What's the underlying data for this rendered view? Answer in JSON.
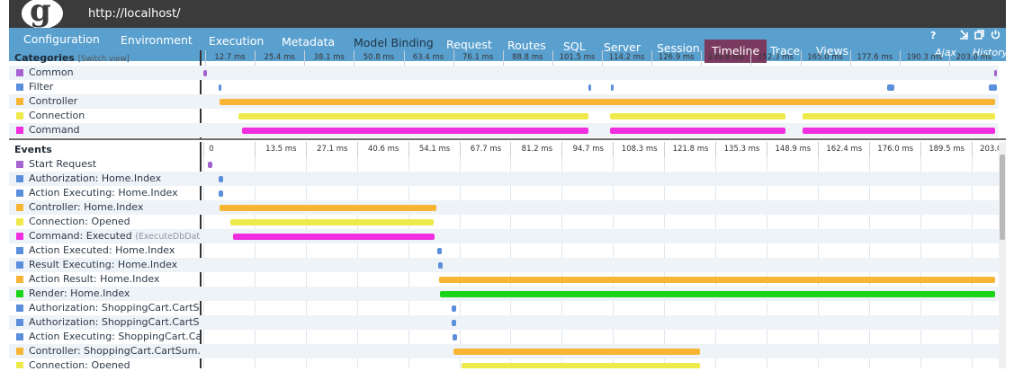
{
  "app": {
    "url": "http://localhost/",
    "logo_letter": "g"
  },
  "tabs": [
    {
      "label": "Configuration"
    },
    {
      "label": "Environment"
    },
    {
      "label": "Execution"
    },
    {
      "label": "Metadata"
    },
    {
      "label": "Model Binding"
    },
    {
      "label": "Request"
    },
    {
      "label": "Routes"
    },
    {
      "label": "SQL"
    },
    {
      "label": "Server"
    },
    {
      "label": "Session"
    },
    {
      "label": "Timeline",
      "active": true
    },
    {
      "label": "Trace"
    },
    {
      "label": "Views"
    },
    {
      "label": "Ajax"
    },
    {
      "label": "History"
    }
  ],
  "controls": {
    "help": "?",
    "popout_icon": "popout-icon",
    "restore_icon": "restore-icon",
    "power_icon": "power-icon"
  },
  "categories": {
    "title": "Categories",
    "switch_view": "[Switch view]",
    "ticks": [
      "12.7 ms",
      "25.4 ms",
      "38.1 ms",
      "50.8 ms",
      "63.4 ms",
      "76.1 ms",
      "88.8 ms",
      "101.5 ms",
      "114.2 ms",
      "126.9 ms",
      "139.6 ms",
      "152.3 ms",
      "165.0 ms",
      "177.6 ms",
      "190.3 ms",
      "203.0 ms"
    ],
    "items": [
      {
        "label": "Common",
        "color": "#a463cf"
      },
      {
        "label": "Filter",
        "color": "#5b8edb"
      },
      {
        "label": "Controller",
        "color": "#f8b533"
      },
      {
        "label": "Connection",
        "color": "#eeea4b"
      },
      {
        "label": "Command",
        "color": "#f02ee0"
      }
    ]
  },
  "events": {
    "title": "Events",
    "ticks": [
      "0",
      "13.5 ms",
      "27.1 ms",
      "40.6 ms",
      "54.1 ms",
      "67.7 ms",
      "81.2 ms",
      "94.7 ms",
      "108.3 ms",
      "121.8 ms",
      "135.3 ms",
      "148.9 ms",
      "162.4 ms",
      "176.0 ms",
      "189.5 ms",
      "203.0 ms"
    ],
    "items": [
      {
        "label": "Start Request",
        "category": "Common",
        "color": "#a463cf",
        "start_ms": 1.2,
        "end_ms": 2.2
      },
      {
        "label": "Authorization: Home.Index",
        "category": "Filter",
        "color": "#5b8edb",
        "start_ms": 3.8,
        "end_ms": 4.8
      },
      {
        "label": "Action Executing: Home.Index",
        "category": "Filter",
        "color": "#5b8edb",
        "start_ms": 4.0,
        "end_ms": 5.0
      },
      {
        "label": "Controller: Home.Index",
        "category": "Controller",
        "color": "#f8b533",
        "start_ms": 4.2,
        "end_ms": 59.5
      },
      {
        "label": "Connection: Opened",
        "category": "Connection",
        "color": "#eeea4b",
        "start_ms": 6.8,
        "end_ms": 59.0
      },
      {
        "label": "Command: Executed",
        "sub": "(ExecuteDbData...",
        "category": "Command",
        "color": "#f02ee0",
        "start_ms": 7.5,
        "end_ms": 59.2
      },
      {
        "label": "Action Executed: Home.Index",
        "category": "Filter",
        "color": "#5b8edb",
        "start_ms": 59.9,
        "end_ms": 60.9
      },
      {
        "label": "Result Executing: Home.Index",
        "category": "Filter",
        "color": "#5b8edb",
        "start_ms": 60.1,
        "end_ms": 61.1
      },
      {
        "label": "Action Result: Home.Index",
        "category": "Controller",
        "color": "#f8b533",
        "start_ms": 60.3,
        "end_ms": 202.5
      },
      {
        "label": "Render: Home.Index",
        "category": "Render",
        "color": "#1bd418",
        "start_ms": 60.6,
        "end_ms": 202.5
      },
      {
        "label": "Authorization: ShoppingCart.CartSu...",
        "category": "Filter",
        "color": "#5b8edb",
        "start_ms": 63.5,
        "end_ms": 64.5
      },
      {
        "label": "Authorization: ShoppingCart.CartSu...",
        "category": "Filter",
        "color": "#5b8edb",
        "start_ms": 63.6,
        "end_ms": 64.6
      },
      {
        "label": "Action Executing: ShoppingCart.Car...",
        "category": "Filter",
        "color": "#5b8edb",
        "start_ms": 63.7,
        "end_ms": 64.7
      },
      {
        "label": "Controller: ShoppingCart.CartSum...",
        "category": "Controller",
        "color": "#f8b533",
        "start_ms": 64.0,
        "end_ms": 127.0
      },
      {
        "label": "Connection: Opened",
        "category": "Connection",
        "color": "#eeea4b",
        "start_ms": 66.0,
        "end_ms": 127.0
      }
    ]
  },
  "category_bars": [
    {
      "row": 0,
      "start_ms": 0.1,
      "end_ms": 1.0
    },
    {
      "row": 0,
      "start_ms": 202.2,
      "end_ms": 203.0
    },
    {
      "row": 1,
      "start_ms": 3.8,
      "end_ms": 4.6
    },
    {
      "row": 1,
      "start_ms": 98.5,
      "end_ms": 99.3
    },
    {
      "row": 1,
      "start_ms": 104.2,
      "end_ms": 105.0
    },
    {
      "row": 1,
      "start_ms": 175.0,
      "end_ms": 176.8
    },
    {
      "row": 1,
      "start_ms": 201.0,
      "end_ms": 203.0
    },
    {
      "row": 2,
      "start_ms": 4.2,
      "end_ms": 202.5
    },
    {
      "row": 3,
      "start_ms": 9.0,
      "end_ms": 98.6
    },
    {
      "row": 3,
      "start_ms": 104.0,
      "end_ms": 148.8
    },
    {
      "row": 3,
      "start_ms": 153.4,
      "end_ms": 202.5
    },
    {
      "row": 4,
      "start_ms": 10.0,
      "end_ms": 98.4
    },
    {
      "row": 4,
      "start_ms": 104.0,
      "end_ms": 148.8
    },
    {
      "row": 4,
      "start_ms": 153.4,
      "end_ms": 202.5
    }
  ]
}
